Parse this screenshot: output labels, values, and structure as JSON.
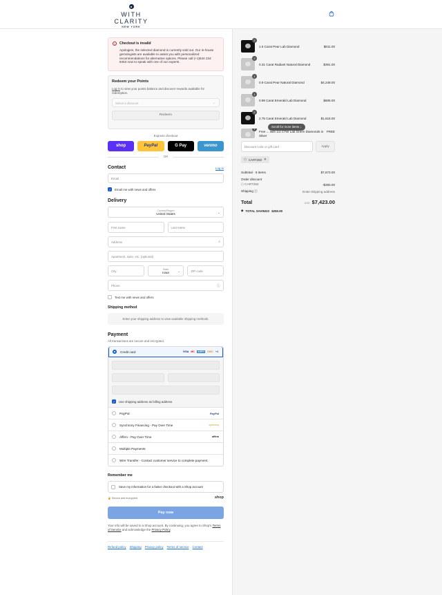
{
  "brand": {
    "name": "WITH CLARITY",
    "sub": "NEW YORK"
  },
  "alert": {
    "title": "Checkout is invalid",
    "text": "Apologies, the selected diamond is currently sold out. Our in-house gemologists are available to assist you with personalized recommendations for alternative options. Please call (+1)844 234 8463 now to speak with one of our experts."
  },
  "redeem": {
    "title": "Redeem your Points",
    "link": "Log in",
    "text": " to view your points balance and discover rewards available for redemption.",
    "select_placeholder": "Select a discount",
    "button": "Redeem"
  },
  "express": {
    "label": "Express checkout",
    "shop": "shop",
    "paypal": "PayPal",
    "gpay": "G Pay",
    "venmo": "venmo",
    "or": "OR"
  },
  "contact": {
    "heading": "Contact",
    "login": "Log in",
    "email_placeholder": "Email",
    "news": "Email me with news and offers"
  },
  "delivery": {
    "heading": "Delivery",
    "country_label": "Country/Region",
    "country_value": "United States",
    "first_name": "First name",
    "last_name": "Last name",
    "address": "Address",
    "apartment": "Apartment, suite, etc. (optional)",
    "city": "City",
    "state_label": "State",
    "state_value": "Iowa",
    "zip": "ZIP code",
    "phone": "Phone",
    "text_news": "Text me with news and offers"
  },
  "shipping": {
    "heading": "Shipping method",
    "notice": "Enter your shipping address to view available shipping methods."
  },
  "payment": {
    "heading": "Payment",
    "subtitle": "All transactions are secure and encrypted.",
    "credit_card": "Credit card",
    "card_logos": [
      "VISA",
      "MC",
      "AMEX",
      "DISC",
      "+4"
    ],
    "billing": "Use shipping address as billing address",
    "options": [
      {
        "label": "PayPal",
        "logo": "PayPal"
      },
      {
        "label": "Synchrony Financing - Pay Over Time",
        "logo": "synchrony"
      },
      {
        "label": "Affirm - Pay Over Time",
        "logo": "affirm"
      },
      {
        "label": "Multiple Payments",
        "logo": ""
      },
      {
        "label": "Wire Transfer - Contact customer service to complete payment.",
        "logo": ""
      }
    ]
  },
  "remember": {
    "heading": "Remember me",
    "save": "Save my information for a faster checkout with a Shop account",
    "secure": "Secure and encrypted",
    "shop": "shop"
  },
  "pay_now": "Pay now",
  "legal": {
    "text1": "Your info will be saved to a Shop account. By continuing, you agree to Shop's ",
    "terms": "Terms of Service",
    "text2": " and acknowledge the ",
    "privacy": "Privacy Policy",
    "text3": "."
  },
  "footer": [
    "Refund policy",
    "Shipping",
    "Privacy policy",
    "Terms of service",
    "Contact"
  ],
  "items": [
    {
      "qty": "2",
      "name": "1.5 Carat Pear Lab Diamond",
      "price": "$811.00",
      "tone": "dark"
    },
    {
      "qty": "2",
      "name": "0.31 Carat Radiant Natural Diamond",
      "price": "$391.00",
      "tone": "light"
    },
    {
      "qty": "1",
      "name": "0.9 Carat Pear Natural Diamond",
      "price": "$4,248.00",
      "tone": "light"
    },
    {
      "qty": "1",
      "name": "0.98 Carat Emerald Lab Diamond",
      "price": "$605.00",
      "tone": "light"
    },
    {
      "qty": "2",
      "name": "2.75 Carat Emerald Lab Diamond",
      "price": "$1,618.00",
      "tone": "dark"
    }
  ],
  "partial_item": {
    "qty": "1",
    "name": "Free ... with 1/2 CTW Lab Green Diamonds in Silver",
    "price": "FREE"
  },
  "tooltip": "Scroll for more items",
  "discount": {
    "placeholder": "Discount code or gift card",
    "apply": "Apply",
    "tag": "CART250"
  },
  "totals": {
    "subtotal_label": "Subtotal · 6 items",
    "subtotal": "$7,673.00",
    "order_discount": "Order discount",
    "code": "CART250",
    "discount_value": "-$250.00",
    "shipping_label": "Shipping",
    "shipping_value": "Enter shipping address",
    "total_label": "Total",
    "currency": "USD",
    "total": "$7,423.00",
    "savings_label": "TOTAL SAVINGS",
    "savings": "$250.00"
  }
}
